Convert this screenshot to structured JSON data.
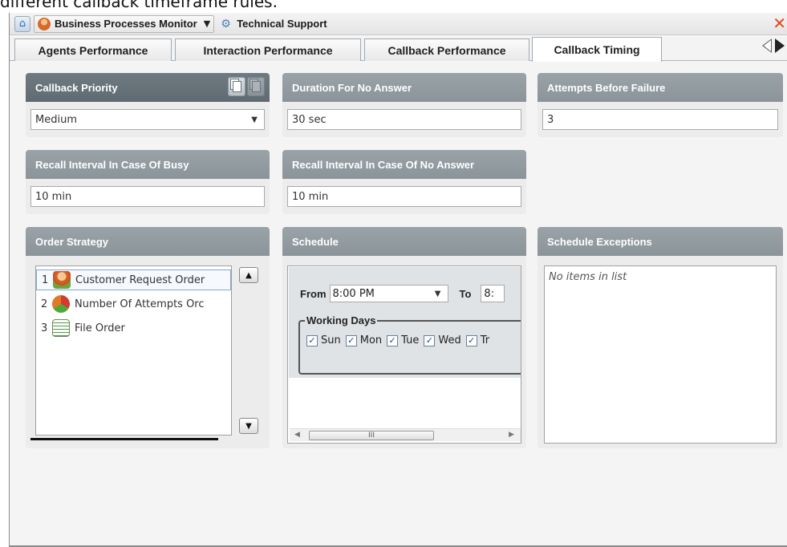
{
  "caption": "different callback timeframe rules.",
  "toolbar": {
    "monitor_label": "Business Processes Monitor",
    "support_label": "Technical Support"
  },
  "tabs": [
    {
      "label": "Agents Performance"
    },
    {
      "label": "Interaction Performance"
    },
    {
      "label": "Callback Performance"
    },
    {
      "label": "Callback Timing"
    }
  ],
  "callback_priority": {
    "title": "Callback Priority",
    "value": "Medium"
  },
  "duration_no_answer": {
    "title": "Duration For No Answer",
    "value": "30 sec"
  },
  "attempts_before_failure": {
    "title": "Attempts Before Failure",
    "value": "3"
  },
  "recall_busy": {
    "title": "Recall Interval In Case Of Busy",
    "value": "10 min"
  },
  "recall_no_answer": {
    "title": "Recall Interval In Case Of No Answer",
    "value": "10 min"
  },
  "order_strategy": {
    "title": "Order Strategy",
    "items": [
      {
        "num": "1",
        "label": "Customer Request Order",
        "icon": "person-icon"
      },
      {
        "num": "2",
        "label": "Number Of Attempts Orc",
        "icon": "recycle-icon"
      },
      {
        "num": "3",
        "label": "File Order",
        "icon": "file-icon"
      }
    ]
  },
  "schedule": {
    "title": "Schedule",
    "from_label": "From",
    "from_value": "8:00 PM",
    "to_label": "To",
    "to_value": "8:",
    "working_days_label": "Working Days",
    "days": [
      {
        "label": "Sun",
        "checked": true
      },
      {
        "label": "Mon",
        "checked": true
      },
      {
        "label": "Tue",
        "checked": true
      },
      {
        "label": "Wed",
        "checked": true
      },
      {
        "label": "Tr",
        "checked": true
      }
    ],
    "scroll_thumb": "III"
  },
  "schedule_exceptions": {
    "title": "Schedule Exceptions",
    "empty_text": "No items in list"
  },
  "colors": {
    "header_gray": "#9aa3a8",
    "header_dark": "#6f7b82",
    "close_orange": "#e3461b",
    "check_blue": "#1f48a0"
  }
}
